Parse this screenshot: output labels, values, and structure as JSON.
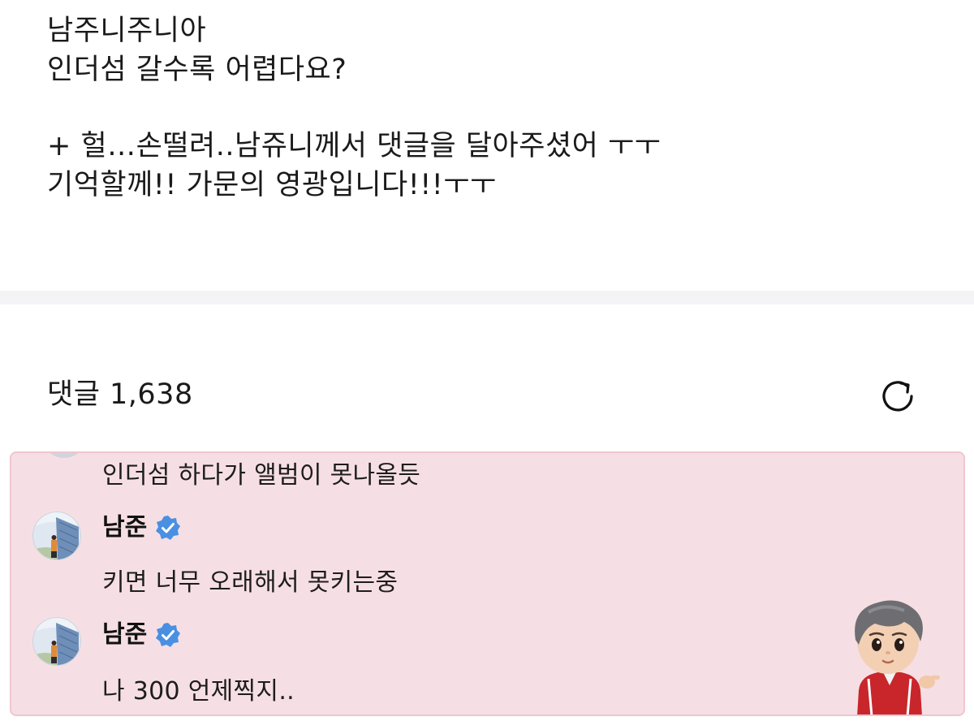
{
  "post": {
    "lines": [
      "남주니주니아",
      "인더섬 갈수록 어렵다요?",
      "",
      "+ 헐…손떨려..남쥬니께서 댓글을 달아주셨어 ㅜㅜ",
      "기억할께!! 가문의 영광입니다!!!ㅜㅜ"
    ]
  },
  "comments": {
    "header_label": "댓글 1,638",
    "refresh_icon": "refresh-icon",
    "items": [
      {
        "author": "",
        "text": "인더섬 하다가 앨범이 못나올듯"
      },
      {
        "author": "남준",
        "verified": true,
        "text": "키면 너무 오래해서 못키는중"
      },
      {
        "author": "남준",
        "verified": true,
        "text": "나 300 언제찍지.."
      }
    ]
  },
  "colors": {
    "panel_bg": "#f6dfe4",
    "panel_border": "#f0c6cf",
    "verified_badge": "#4a90e2",
    "separator": "#f4f4f6"
  }
}
